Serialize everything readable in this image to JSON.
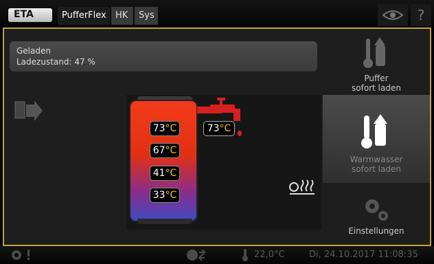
{
  "header": {
    "logo_text": "ETA",
    "tabs": [
      {
        "label": "PufferFlex",
        "active": true
      },
      {
        "label": "HK",
        "active": false
      },
      {
        "label": "Sys",
        "active": false
      }
    ],
    "help_label": "?"
  },
  "status": {
    "line1": "Geladen",
    "line2": "Ladezustand: 47 %"
  },
  "tank": {
    "temps": [
      {
        "value": "73",
        "unit": "°C"
      },
      {
        "value": "67",
        "unit": "°C"
      },
      {
        "value": "41",
        "unit": "°C"
      },
      {
        "value": "33",
        "unit": "°C"
      }
    ],
    "tap_temp": {
      "value": "73",
      "unit": "°C"
    }
  },
  "right": {
    "buffer_label1": "Puffer",
    "buffer_label2": "sofort laden",
    "warmwater_label1": "Warmwasser",
    "warmwater_label2": "sofort laden",
    "settings_label": "Einstellungen"
  },
  "footer": {
    "ambient_temp": "22,0°C",
    "datetime": "Di, 24.10.2017 11:08:35"
  },
  "colors": {
    "accent": "#c4a23a",
    "tank_top": "#f33b1a",
    "tank_bottom": "#3b4cc6",
    "temp_unit": "#f5c800"
  }
}
